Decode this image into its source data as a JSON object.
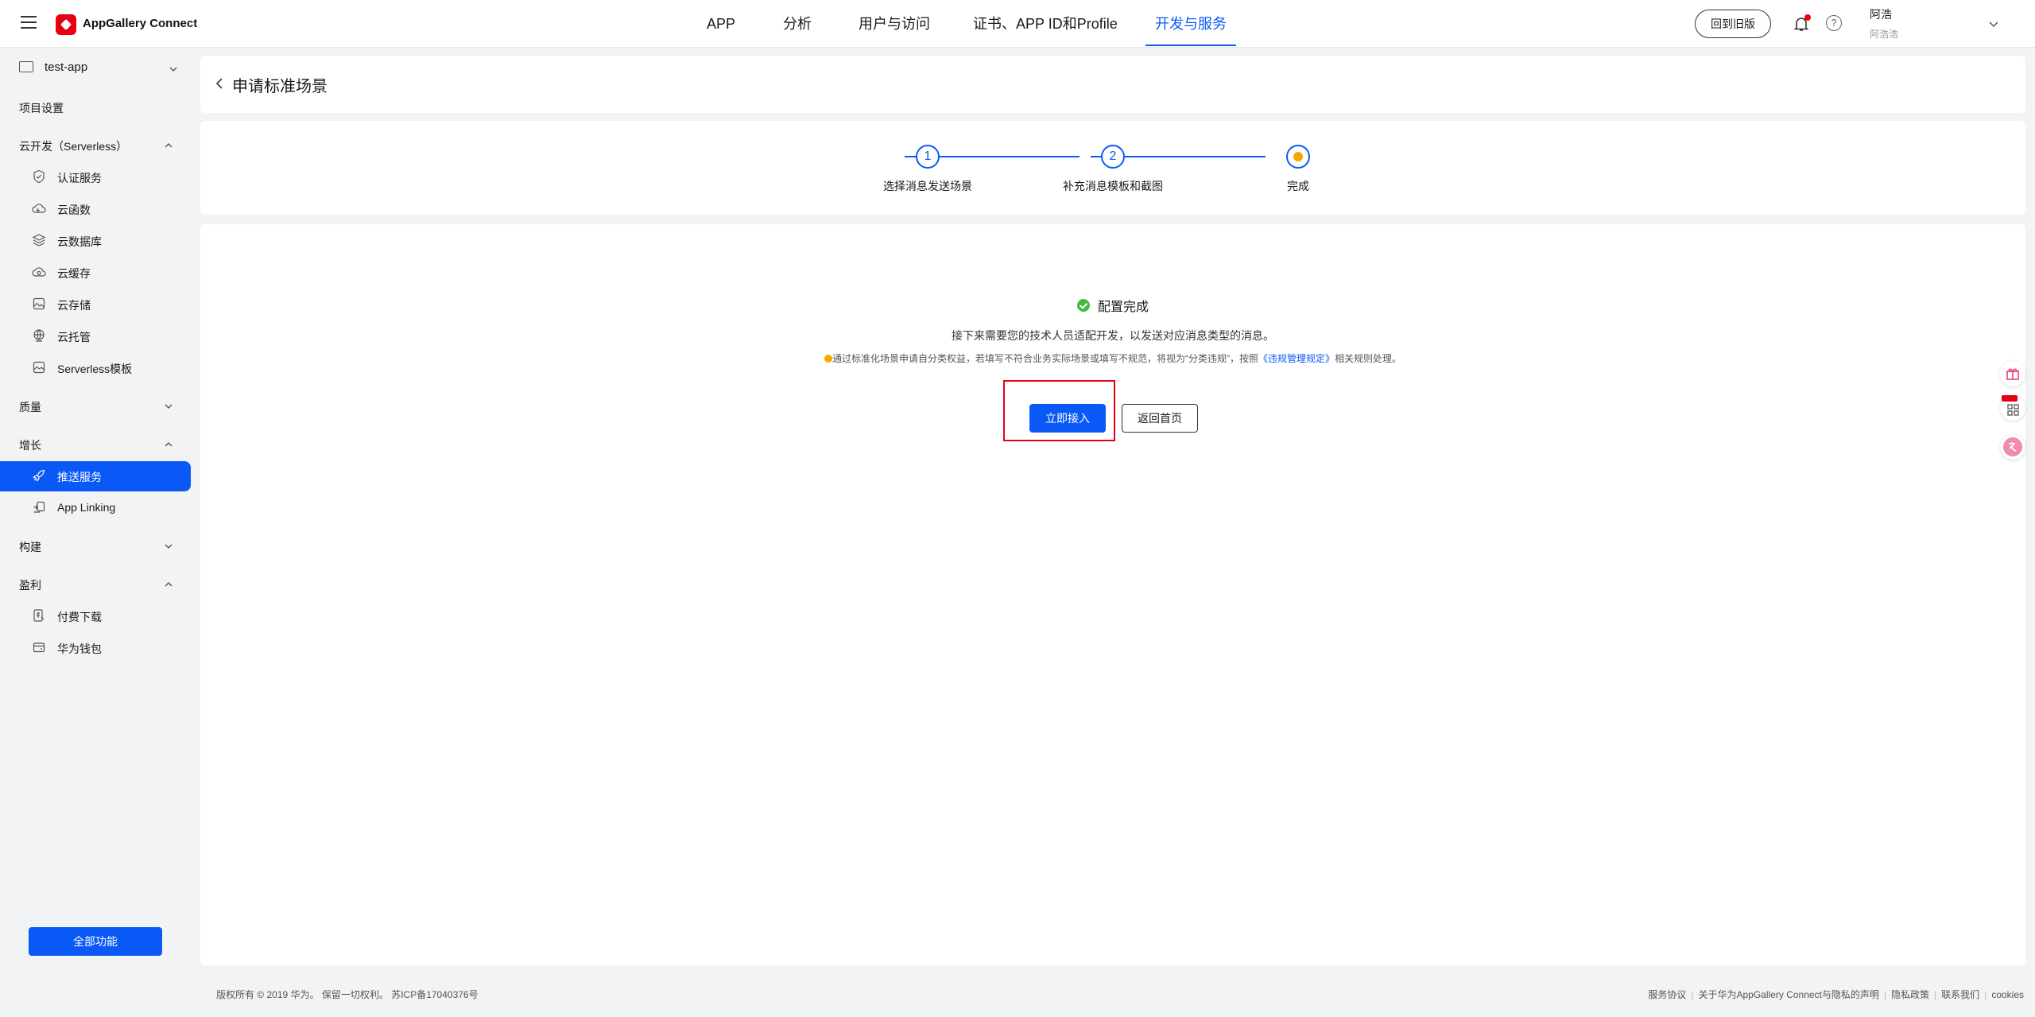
{
  "brand": {
    "name": "AppGallery Connect",
    "color": "#e60012"
  },
  "accent": "#0a59f7",
  "topnav": {
    "items": [
      "APP",
      "分析",
      "用户与访问",
      "证书、APP ID和Profile",
      "开发与服务"
    ],
    "active": "开发与服务"
  },
  "header": {
    "old_version": "回到旧版",
    "user_name": "阿浩",
    "user_sub": "阿浩浩"
  },
  "sidebar": {
    "project": "test-app",
    "project_settings": "项目设置",
    "serverless": {
      "label": "云开发（Serverless）",
      "items": [
        "认证服务",
        "云函数",
        "云数据库",
        "云缓存",
        "云存储",
        "云托管",
        "Serverless模板"
      ]
    },
    "quality": "质量",
    "growth": {
      "label": "增长",
      "items": [
        "推送服务",
        "App Linking"
      ],
      "active": "推送服务"
    },
    "build": "构建",
    "monetize": {
      "label": "盈利",
      "items": [
        "付费下载",
        "华为钱包"
      ]
    },
    "all_features": "全部功能"
  },
  "page": {
    "title": "申请标准场景"
  },
  "steps": [
    {
      "num": "1",
      "label": "选择消息发送场景"
    },
    {
      "num": "2",
      "label": "补充消息模板和截图"
    },
    {
      "num": "",
      "label": "完成"
    }
  ],
  "result": {
    "title": "配置完成",
    "next": "接下来需要您的技术人员适配开发，以发送对应消息类型的消息。",
    "warning_pre": "通过标准化场景申请自分类权益，若填写不符合业务实际场景或填写不规范，将视为“分类违规”，按照",
    "warning_link": "《违规管理规定》",
    "warning_post": "相关规则处理。",
    "primary_button": "立即接入",
    "secondary_button": "返回首页"
  },
  "float_widgets": [
    "gift-icon",
    "new-grid-icon",
    "translate-icon"
  ],
  "footer": {
    "copyright": "版权所有 © 2019 华为。 保留一切权利。 苏ICP备17040376号",
    "links": [
      "服务协议",
      "关于华为AppGallery Connect与隐私的声明",
      "隐私政策",
      "联系我们",
      "cookies"
    ]
  }
}
